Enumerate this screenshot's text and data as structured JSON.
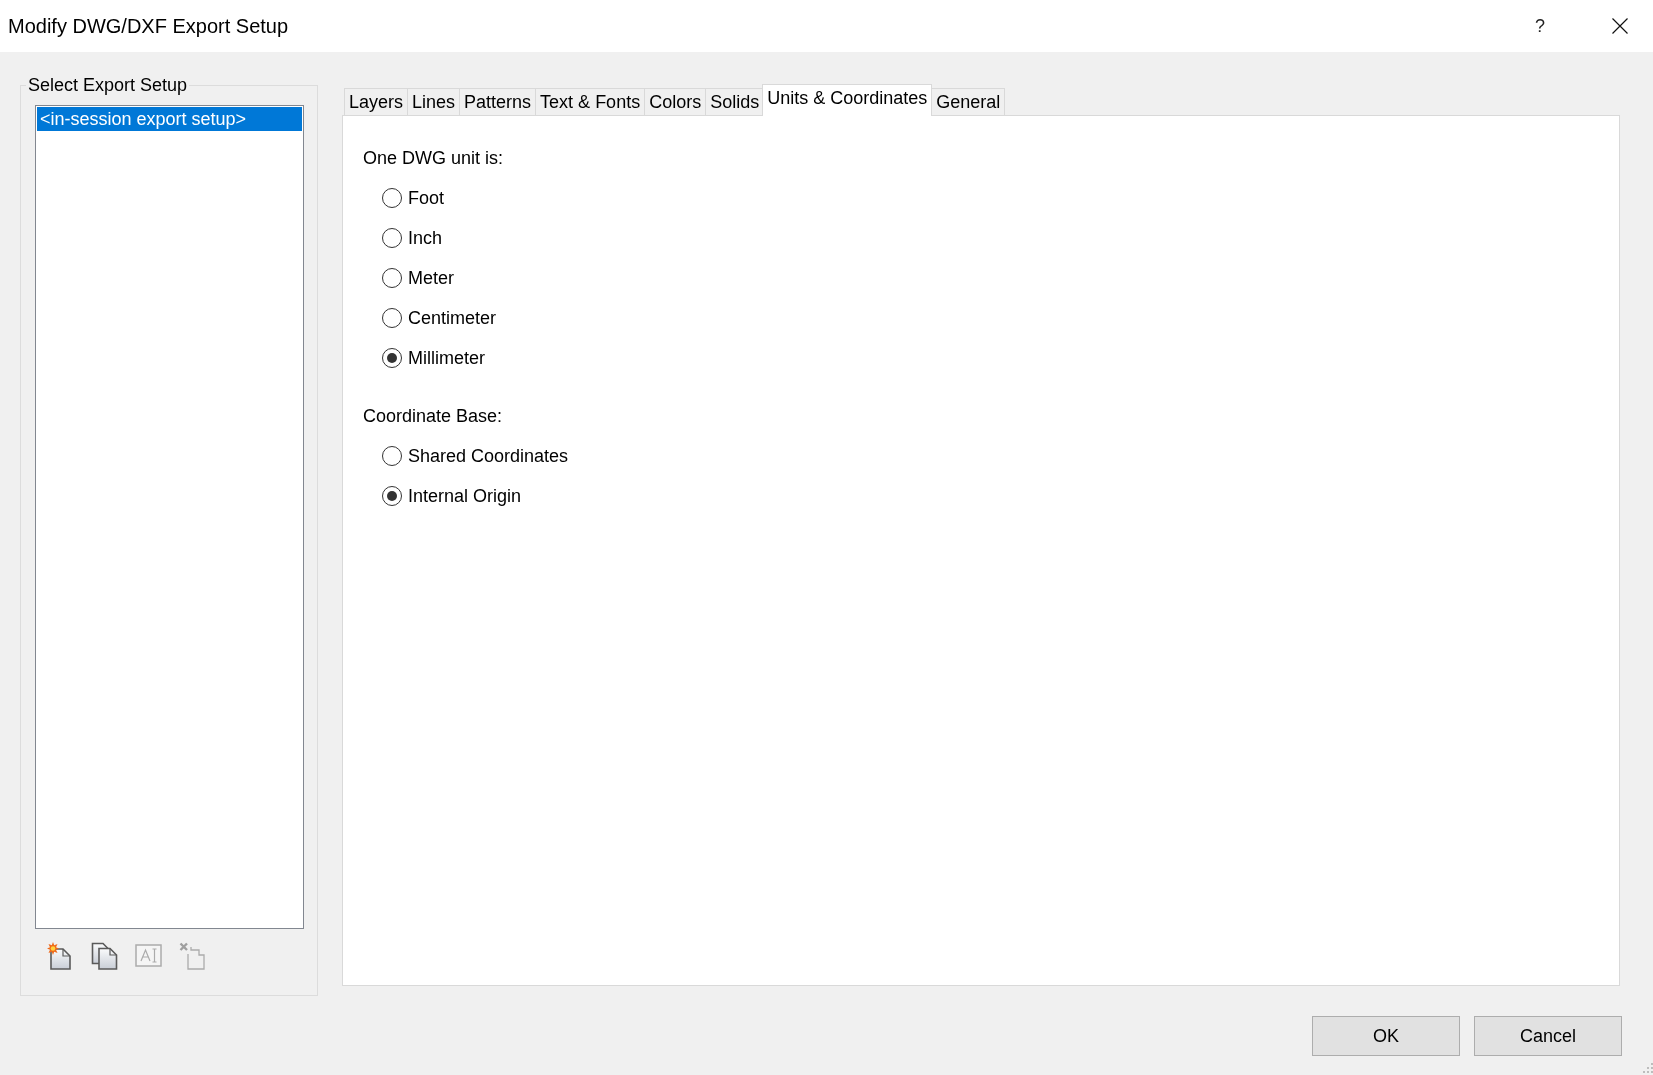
{
  "window": {
    "title": "Modify DWG/DXF Export Setup",
    "help_button": "?"
  },
  "export_setup": {
    "label": "Select Export Setup",
    "items": [
      {
        "label": "<in-session export setup>",
        "selected": true
      }
    ]
  },
  "setup_tools": [
    {
      "kind": "new",
      "disabled": false
    },
    {
      "kind": "duplicate",
      "disabled": false
    },
    {
      "kind": "rename",
      "disabled": true
    },
    {
      "kind": "delete",
      "disabled": true
    }
  ],
  "tabs": [
    {
      "label": "Layers",
      "selected": false
    },
    {
      "label": "Lines",
      "selected": false
    },
    {
      "label": "Patterns",
      "selected": false
    },
    {
      "label": "Text & Fonts",
      "selected": false
    },
    {
      "label": "Colors",
      "selected": false
    },
    {
      "label": "Solids",
      "selected": false
    },
    {
      "label": "Units & Coordinates",
      "selected": true
    },
    {
      "label": "General",
      "selected": false
    }
  ],
  "tab_panel": {
    "groups": [
      {
        "label": "One DWG unit is:",
        "options": [
          {
            "label": "Foot",
            "selected": false
          },
          {
            "label": "Inch",
            "selected": false
          },
          {
            "label": "Meter",
            "selected": false
          },
          {
            "label": "Centimeter",
            "selected": false
          },
          {
            "label": "Millimeter",
            "selected": true
          }
        ]
      },
      {
        "label": "Coordinate Base:",
        "options": [
          {
            "label": "Shared Coordinates",
            "selected": false
          },
          {
            "label": "Internal Origin",
            "selected": true
          }
        ]
      }
    ]
  },
  "buttons": [
    "OK",
    "Cancel"
  ]
}
